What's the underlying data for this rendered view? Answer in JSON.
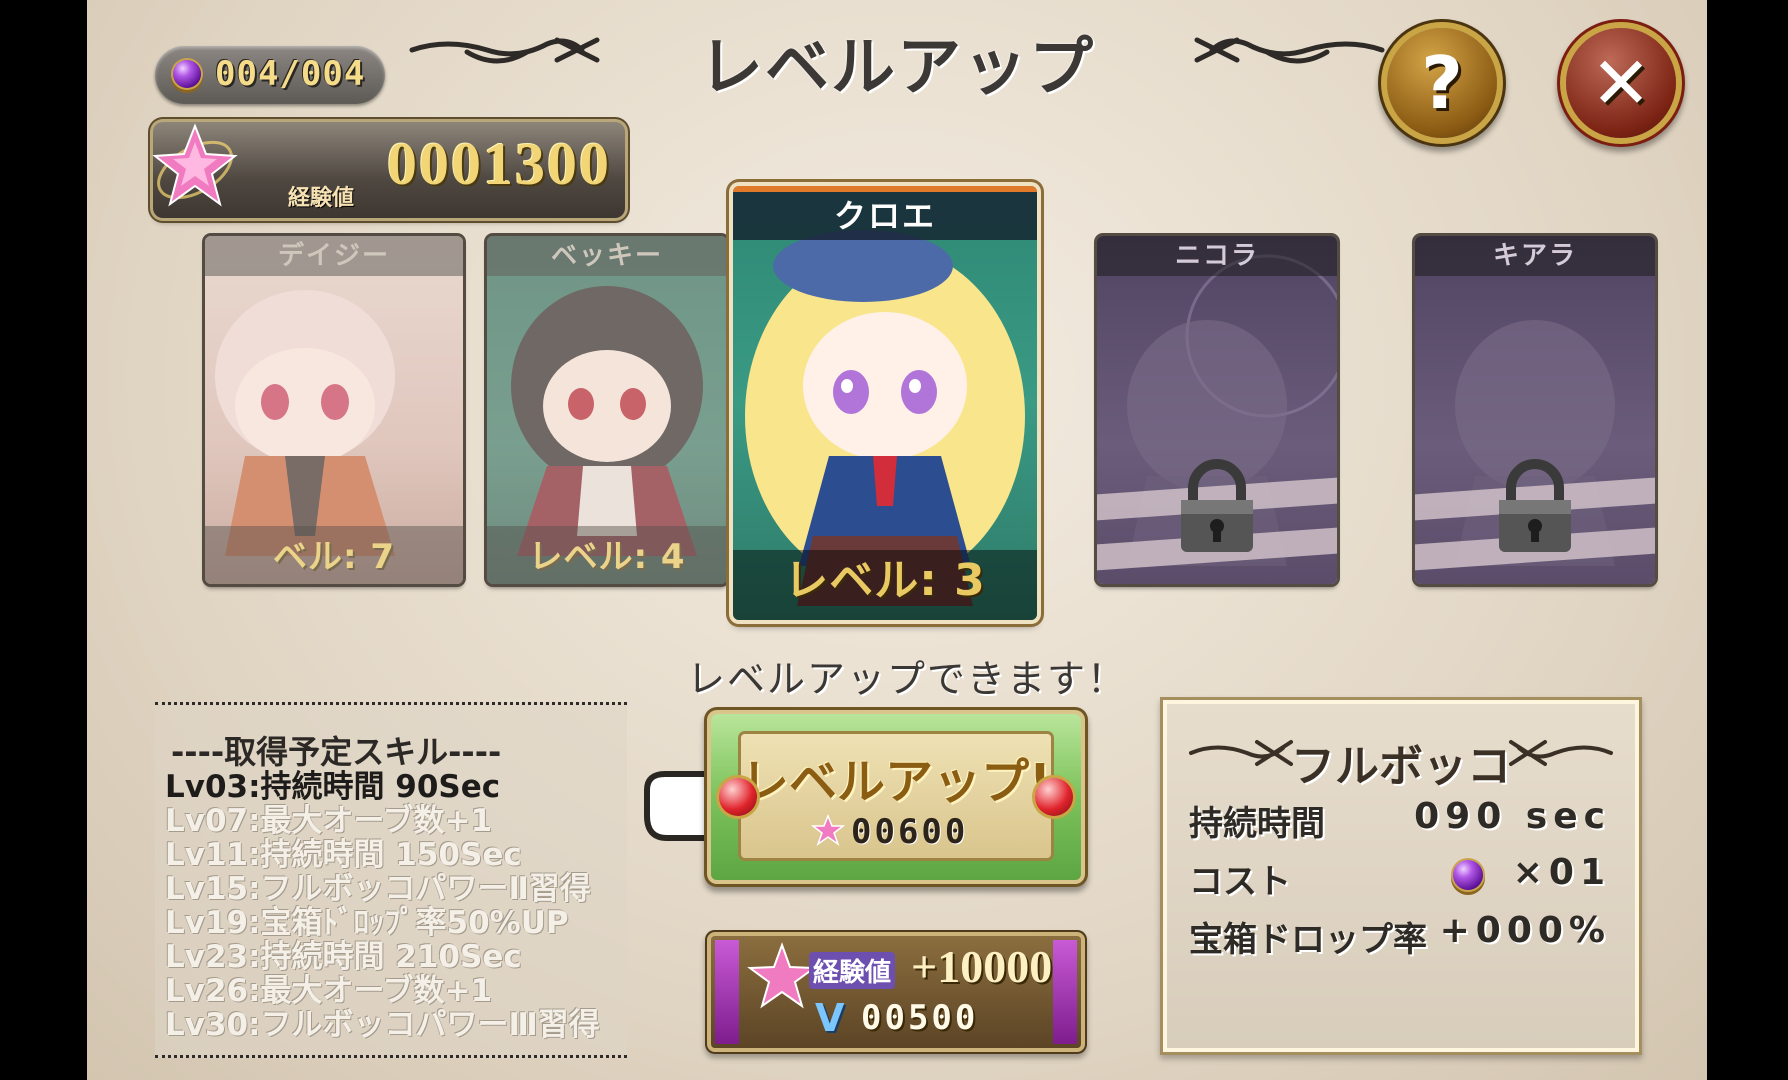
{
  "header": {
    "title": "レベルアップ",
    "orb_count": "004/004",
    "exp_value": "0001300",
    "exp_label": "経験値",
    "help_symbol": "?",
    "close_symbol": "✕"
  },
  "characters": [
    {
      "name": "デイジー",
      "level": "ベル: 7",
      "state": "unlocked"
    },
    {
      "name": "ベッキー",
      "level": "レベル: 4",
      "state": "unlocked"
    },
    {
      "name": "クロエ",
      "level": "レベル: 3",
      "state": "selected"
    },
    {
      "name": "ニコラ",
      "level": "",
      "state": "locked"
    },
    {
      "name": "キアラ",
      "level": "",
      "state": "locked"
    }
  ],
  "status_message": "レベルアップできます！",
  "skills": {
    "header": "----取得予定スキル----",
    "items": [
      {
        "text": "Lv03:持続時間 90Sec",
        "active": true
      },
      {
        "text": "Lv07:最大オーブ数+1",
        "active": false
      },
      {
        "text": "Lv11:持続時間 150Sec",
        "active": false
      },
      {
        "text": "Lv15:フルボッコパワーⅡ習得",
        "active": false
      },
      {
        "text": "Lv19:宝箱ﾄﾞﾛｯﾌﾟ率50%UP",
        "active": false
      },
      {
        "text": "Lv23:持続時間 210Sec",
        "active": false
      },
      {
        "text": "Lv26:最大オーブ数+1",
        "active": false
      },
      {
        "text": "Lv30:フルボッコパワーⅢ習得",
        "active": false
      }
    ]
  },
  "level_up_button": {
    "label": "レベルアップ!",
    "cost": "00600"
  },
  "exp_boost_button": {
    "label": "経験値",
    "amount": "+10000",
    "cost": "00500",
    "currency_symbol": "V"
  },
  "skill_detail": {
    "name": "フルボッコ",
    "rows": [
      {
        "key": "持続時間",
        "value": "090 sec"
      },
      {
        "key": "コスト",
        "value": "×01"
      },
      {
        "key": "宝箱ドロップ率",
        "value": "+000%"
      }
    ]
  },
  "colors": {
    "gold": "#f2d577",
    "accent_green": "#7cc25b",
    "close_red": "#7c2314",
    "panel_bg": "#e4d9c8"
  },
  "icons": [
    "purple-orb-icon",
    "exp-star-icon",
    "help-icon",
    "close-icon",
    "lock-icon",
    "pointing-hand-icon",
    "red-gem-icon",
    "v-currency-icon"
  ]
}
